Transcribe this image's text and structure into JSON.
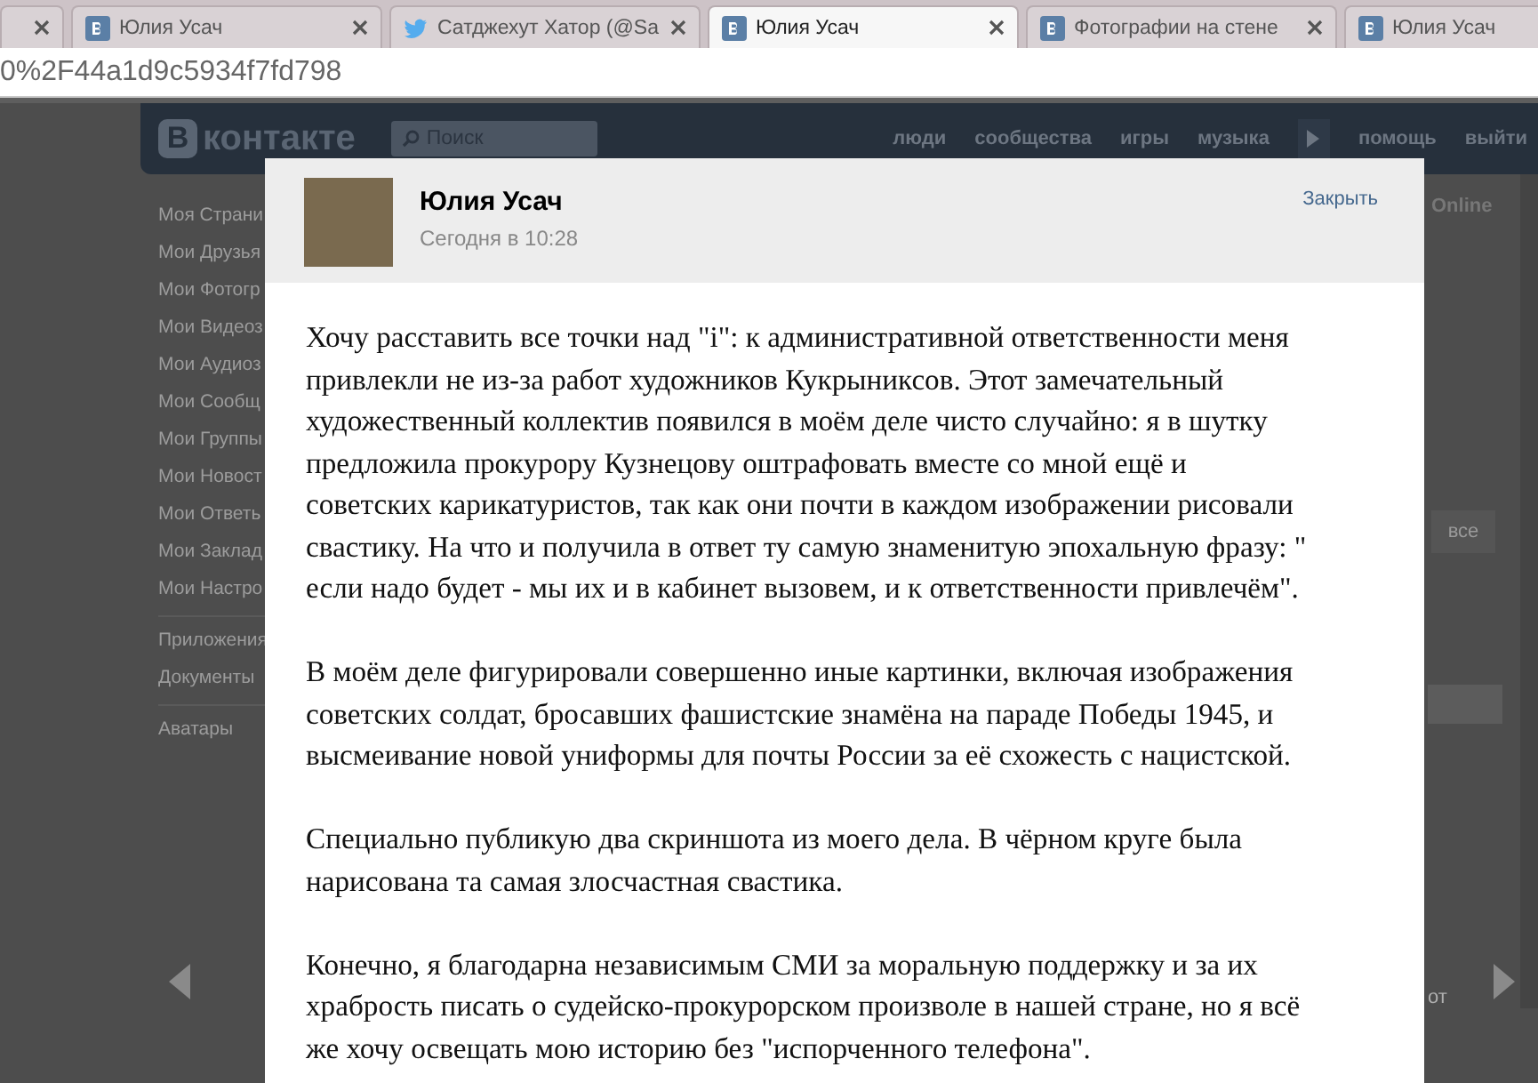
{
  "browser": {
    "tabs": [
      {
        "selected": false
      },
      {
        "title": "Юлия Усач",
        "selected": false
      },
      {
        "title": "Сатджехут Хатор (@Sa",
        "selected": false
      },
      {
        "title": "Юлия Усач",
        "selected": true
      },
      {
        "title": "Фотографии на стене",
        "selected": false
      },
      {
        "title": "Юлия Усач",
        "selected": false
      }
    ],
    "address": "0%2F44a1d9c5934f7fd798"
  },
  "site": {
    "logo": "контакте",
    "logo_mark": "В",
    "search_placeholder": "Поиск",
    "nav": [
      "люди",
      "сообщества",
      "игры",
      "музыка",
      "помощь",
      "выйти"
    ],
    "sidebar": [
      [
        "Моя Страни",
        "Мои Друзья",
        "Мои Фотогр",
        "Мои Видеоз",
        "Мои Аудиоз",
        "Мои Сообщ",
        "Мои Группы",
        "Мои Новост",
        "Мои Ответь",
        "Мои Заклад",
        "Мои Настро"
      ],
      [
        "Приложения",
        "Документы"
      ],
      [
        "Аватары"
      ]
    ],
    "online": "Online",
    "all_button": "все",
    "footer_text": "от"
  },
  "post": {
    "author": "Юлия Усач",
    "time": "Сегодня в 10:28",
    "close": "Закрыть",
    "paragraphs": [
      [
        "Хочу расставить все точки над \"i\": к административной ответственности меня",
        "привлекли не из-за работ художников Кукрыниксов. Этот замечательный",
        "художественный коллектив появился в моём деле чисто случайно: я в шутку",
        "предложила прокурору Кузнецову оштрафовать вместе со мной ещё и",
        "советских карикатуристов, так как они почти в каждом изображении рисовали",
        "свастику. На что и получила в ответ ту самую знаменитую эпохальную фразу: \"",
        "если надо будет - мы их и в кабинет вызовем, и к ответственности привлечём\"."
      ],
      [
        "В моём деле фигурировали совершенно иные картинки, включая изображения",
        "советских солдат, бросавших фашистские знамёна на параде Победы 1945, и",
        "высмеивание новой униформы для почты России за её схожесть с нацистской."
      ],
      [
        "Специально публикую два скриншота из моего дела. В чёрном круге была",
        "нарисована та самая злосчастная свастика."
      ],
      [
        "Конечно, я благодарна независимым СМИ за моральную поддержку и за их",
        "храбрость писать о судейско-прокурорском произволе в нашей стране, но я всё",
        "же хочу освещать мою историю без \"испорченного телефона\"."
      ]
    ]
  }
}
